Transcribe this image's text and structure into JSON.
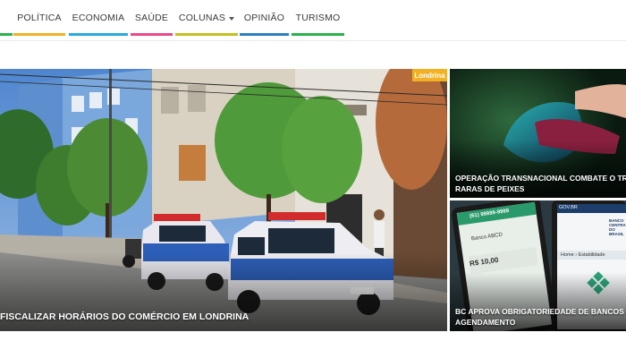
{
  "nav": {
    "items": [
      {
        "label": "POLÍTICA",
        "color": "#2ab24c"
      },
      {
        "label": "ECONOMIA",
        "color": "#f2b124"
      },
      {
        "label": "SAÚDE",
        "color": "#27a9e0"
      },
      {
        "label": "COLUNAS",
        "color": "#e84b8a"
      },
      {
        "label": "OPINIÃO",
        "color": "#c1c21f"
      },
      {
        "label": "TURISMO",
        "color": "#2c7fc3"
      }
    ],
    "trailing_color": "#2ab24c"
  },
  "hero": {
    "tag": "Londrina",
    "tag_color": "#f2b124",
    "title": "FISCALIZAR HORÁRIOS DO COMÉRCIO EM LONDRINA"
  },
  "side_cards": [
    {
      "title_line1": "OPERAÇÃO TRANSNACIONAL COMBATE O TRÁ",
      "title_line2": "RARAS DE PEIXES"
    },
    {
      "title_line1": "BC APROVA OBRIGATORIEDADE DE BANCOS OF",
      "title_line2": "AGENDAMENTO"
    }
  ],
  "phone_screen": {
    "network": "GOV.BR",
    "bank_header": "BANCO CENTRAL DO BRASIL",
    "breadcrumb_home": "Home",
    "breadcrumb_next": "Estabilidade",
    "left_phone_number": "(61) 99999-9999",
    "left_phone_bank": "Banco ABCD",
    "left_phone_value": "R$ 10,00"
  }
}
